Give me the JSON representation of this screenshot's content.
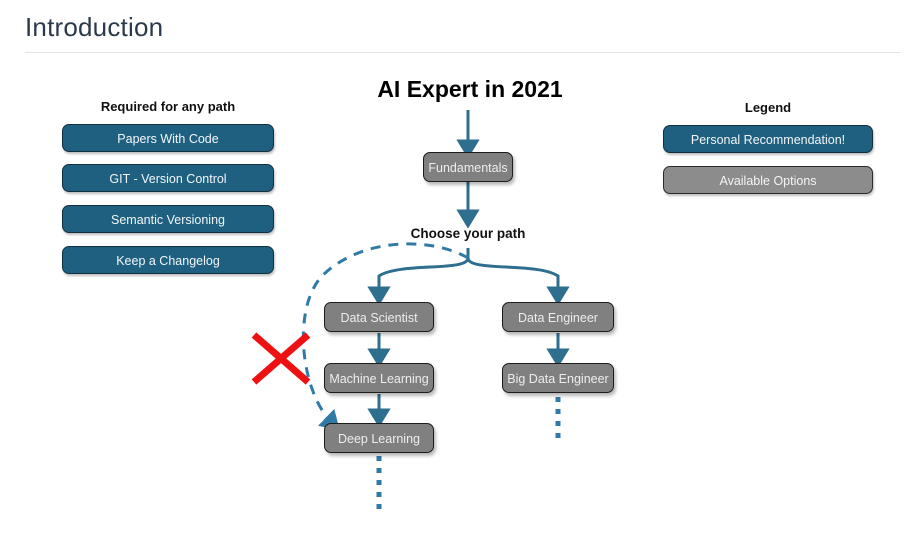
{
  "header": {
    "title": "Introduction"
  },
  "colors": {
    "title": "#2b3a4a",
    "accent_blue": "#1f6080",
    "arrow_blue": "#2e6e8e",
    "node_gray": "#808080",
    "cross_red": "#ee1111",
    "rule": "#e3e3e3"
  },
  "required_section": {
    "heading": "Required for any path",
    "items": [
      {
        "label": "Papers With Code"
      },
      {
        "label": "GIT - Version Control"
      },
      {
        "label": "Semantic Versioning"
      },
      {
        "label": "Keep a Changelog"
      }
    ]
  },
  "legend_section": {
    "heading": "Legend",
    "items": [
      {
        "label": "Personal Recommendation!",
        "style": "blue"
      },
      {
        "label": "Available Options",
        "style": "gray"
      }
    ]
  },
  "flow": {
    "title": "AI Expert in 2021",
    "choose_label": "Choose your path",
    "nodes": [
      {
        "label": "Fundamentals"
      },
      {
        "label": "Data Scientist"
      },
      {
        "label": "Machine Learning"
      },
      {
        "label": "Deep Learning"
      },
      {
        "label": "Data Engineer"
      },
      {
        "label": "Big Data Engineer"
      }
    ],
    "blocked_marker": "red-x-cross",
    "shortcut_note": "dashed curve from choose-your-path to Deep Learning, crossed out"
  }
}
